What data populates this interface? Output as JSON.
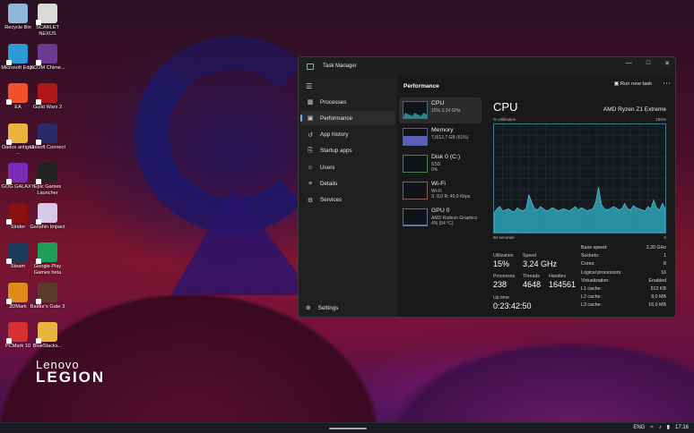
{
  "desktop": {
    "icons": [
      {
        "label": "Recycle Bin",
        "color": "#8fb8d8"
      },
      {
        "label": "SCARLET NEXUS",
        "color": "#d9d9d9"
      },
      {
        "label": "Microsoft Edge",
        "color": "#2a9bd6"
      },
      {
        "label": "XCOM Chime...",
        "color": "#6a3b8f"
      },
      {
        "label": "EA",
        "color": "#f0502a"
      },
      {
        "label": "Guild Wars 2",
        "color": "#b01818"
      },
      {
        "label": "Dados antigos ...",
        "color": "#e9b43c"
      },
      {
        "label": "Ubisoft Connect",
        "color": "#2a2a6a"
      },
      {
        "label": "GOG GALAXY",
        "color": "#7a2bb8"
      },
      {
        "label": "Epic Games Launcher",
        "color": "#222222"
      },
      {
        "label": "Strider",
        "color": "#8a1010"
      },
      {
        "label": "Genshin Impact",
        "color": "#d8c8e8"
      },
      {
        "label": "Steam",
        "color": "#1b3a5c"
      },
      {
        "label": "Google Play Games beta",
        "color": "#1f9e5a"
      },
      {
        "label": "3DMark",
        "color": "#e08a1a"
      },
      {
        "label": "Baldur's Gate 3",
        "color": "#5a3a2a"
      },
      {
        "label": "PCMark 10",
        "color": "#d83030"
      },
      {
        "label": "BlueStacks...",
        "color": "#e9b43c"
      }
    ],
    "logo_line1": "Lenovo",
    "logo_line2": "LEGION"
  },
  "taskbar": {
    "lang": "ENG",
    "time": "17:16"
  },
  "task_manager": {
    "title": "Task Manager",
    "header_title": "Performance",
    "run_new_task": "Run new task",
    "nav": [
      {
        "label": "Processes",
        "icon": "grid-icon"
      },
      {
        "label": "Performance",
        "icon": "performance-icon"
      },
      {
        "label": "App history",
        "icon": "history-icon"
      },
      {
        "label": "Startup apps",
        "icon": "startup-icon"
      },
      {
        "label": "Users",
        "icon": "users-icon"
      },
      {
        "label": "Details",
        "icon": "details-icon"
      },
      {
        "label": "Services",
        "icon": "services-icon"
      }
    ],
    "settings": "Settings",
    "resources": [
      {
        "name": "CPU",
        "sub1": "15% 3,24 GHz",
        "sub2": ""
      },
      {
        "name": "Memory",
        "sub1": "7,8/12,7 GB (61%)",
        "sub2": ""
      },
      {
        "name": "Disk 0 (C:)",
        "sub1": "SSD",
        "sub2": "0%"
      },
      {
        "name": "Wi-Fi",
        "sub1": "Wi-Fi",
        "sub2": "S: 8,0  R: 40,0 Kbps"
      },
      {
        "name": "GPU 0",
        "sub1": "AMD Radeon Graphics",
        "sub2": "4% (54 °C)"
      }
    ],
    "cpu": {
      "title": "CPU",
      "model": "AMD Ryzen Z1 Extreme",
      "util_label": "% Utilization",
      "max_label": "100%",
      "seconds_label": "60 seconds",
      "zero_label": "0",
      "utilization_label": "Utilization",
      "utilization": "15%",
      "speed_label": "Speed",
      "speed": "3,24 GHz",
      "processes_label": "Processes",
      "processes": "238",
      "threads_label": "Threads",
      "threads": "4648",
      "handles_label": "Handles",
      "handles": "164561",
      "uptime_label": "Up time",
      "uptime": "0:23:42:50",
      "specs": [
        {
          "k": "Base speed:",
          "v": "3,30 GHz"
        },
        {
          "k": "Sockets:",
          "v": "1"
        },
        {
          "k": "Cores:",
          "v": "8"
        },
        {
          "k": "Logical processors:",
          "v": "16"
        },
        {
          "k": "Virtualization:",
          "v": "Enabled"
        },
        {
          "k": "L1 cache:",
          "v": "512 KB"
        },
        {
          "k": "L2 cache:",
          "v": "8,0 MB"
        },
        {
          "k": "L3 cache:",
          "v": "16,0 MB"
        }
      ],
      "history": [
        18,
        22,
        24,
        20,
        21,
        22,
        20,
        19,
        23,
        21,
        20,
        22,
        35,
        28,
        22,
        21,
        24,
        22,
        20,
        21,
        23,
        22,
        20,
        21,
        22,
        21,
        20,
        22,
        24,
        21,
        23,
        22,
        20,
        21,
        22,
        28,
        42,
        26,
        22,
        21,
        22,
        24,
        23,
        21,
        22,
        27,
        22,
        21,
        25,
        23,
        22,
        21,
        20,
        24,
        22,
        30,
        23,
        21,
        27,
        22
      ]
    },
    "accent": "#5fb2f2",
    "graph_color": "#2aa4b8"
  }
}
